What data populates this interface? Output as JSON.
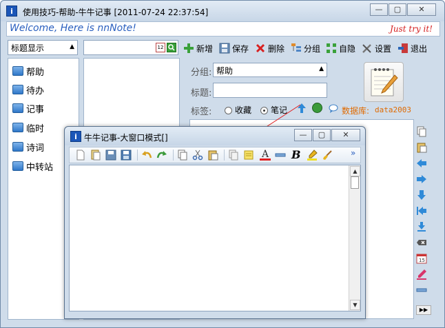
{
  "main": {
    "title": "使用技巧-帮助-牛牛记事 [2011-07-24 22:37:54]",
    "welcome": "Welcome, Here is nnNote!",
    "tryit": "Just try it!",
    "display_mode": "标题显示",
    "toolbar": {
      "add": "新增",
      "save": "保存",
      "delete": "删除",
      "group": "分组",
      "autohide": "自隐",
      "settings": "设置",
      "exit": "退出"
    },
    "sidebar": [
      {
        "label": "帮助"
      },
      {
        "label": "待办"
      },
      {
        "label": "记事"
      },
      {
        "label": "临时"
      },
      {
        "label": "诗词"
      },
      {
        "label": "中转站"
      }
    ],
    "form": {
      "group_label": "分组:",
      "group_value": "帮助",
      "title_label": "标题:",
      "title_value": "",
      "tag_label": "标签:",
      "tag_option1": "收藏",
      "tag_option2": "笔记",
      "db_label": "数据库:",
      "db_value": "data2003"
    }
  },
  "child": {
    "title": "牛牛记事-大窗口模式[]",
    "more": "»"
  },
  "colors": {
    "accent": "#2a5fbf",
    "tryit": "#d41c1c",
    "db_label": "#e06a00"
  }
}
